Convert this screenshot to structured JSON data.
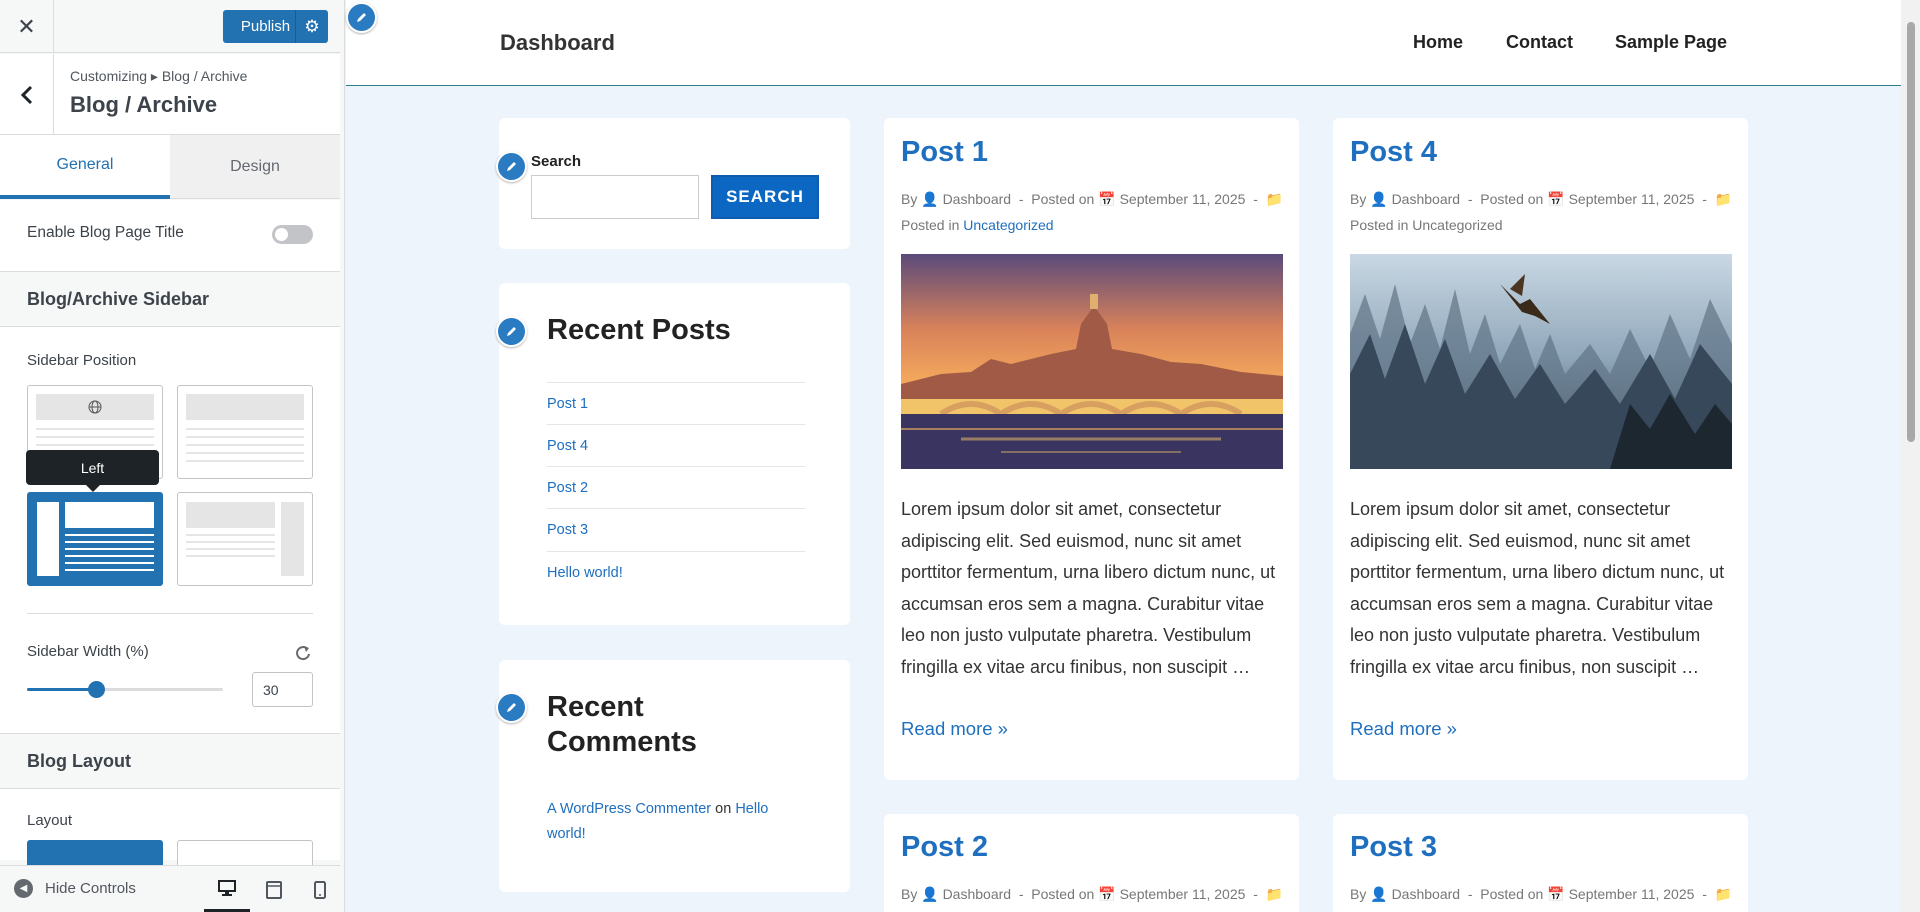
{
  "panel": {
    "publish_label": "Publish",
    "breadcrumb": "Customizing ▸ Blog / Archive",
    "section_title": "Blog / Archive",
    "tabs": [
      {
        "label": "General",
        "active": true
      },
      {
        "label": "Design",
        "active": false
      }
    ],
    "enable_title_label": "Enable Blog Page Title",
    "enable_title_on": false,
    "sidebar_group_title": "Blog/Archive Sidebar",
    "sidebar_position_label": "Sidebar Position",
    "sidebar_position_tooltip": "Left",
    "sidebar_position_selected": "left",
    "sidebar_width_label": "Sidebar Width (%)",
    "sidebar_width_value": "30",
    "sidebar_width_fraction": 0.35,
    "layout_group_title": "Blog Layout",
    "layout_label": "Layout",
    "hide_controls_label": "Hide Controls"
  },
  "site": {
    "title": "Dashboard",
    "nav": [
      "Home",
      "Contact",
      "Sample Page"
    ]
  },
  "sidebar": {
    "search_label": "Search",
    "search_button": "SEARCH",
    "recent_posts_title": "Recent Posts",
    "recent_posts": [
      "Post 1",
      "Post 4",
      "Post 2",
      "Post 3",
      "Hello world!"
    ],
    "recent_comments_title": "Recent Comments",
    "comment_author": "A WordPress Commenter",
    "comment_on": "on",
    "comment_post": "Hello world!"
  },
  "posts": [
    {
      "title": "Post 1",
      "by": "By",
      "author": "Dashboard",
      "posted_on": "Posted on",
      "date": "September 11, 2025",
      "posted_in": "Posted in",
      "category": "Uncategorized",
      "excerpt_lines": [
        "Lorem ipsum dolor sit amet, consectetur",
        "adipiscing elit. Sed euismod, nunc sit amet",
        "porttitor fermentum, urna libero dictum nunc, ut",
        "accumsan eros sem a magna. Curabitur vitae",
        "leo non justo vulputate pharetra. Vestibulum",
        "fringilla ex vitae arcu finibus, non suscipit …"
      ],
      "read_more": "Read more »"
    },
    {
      "title": "Post 4",
      "by": "By",
      "author": "Dashboard",
      "posted_on": "Posted on",
      "date": "September 11, 2025",
      "posted_in": "Posted in",
      "category": "Uncategorized",
      "excerpt_lines": [
        "Lorem ipsum dolor sit amet, consectetur",
        "adipiscing elit. Sed euismod, nunc sit amet",
        "porttitor fermentum, urna libero dictum nunc, ut",
        "accumsan eros sem a magna. Curabitur vitae",
        "leo non justo vulputate pharetra. Vestibulum",
        "fringilla ex vitae arcu finibus, non suscipit …"
      ],
      "read_more": "Read more »"
    },
    {
      "title": "Post 2",
      "by": "By",
      "author": "Dashboard",
      "posted_on": "Posted on",
      "date": "September 11, 2025"
    },
    {
      "title": "Post 3",
      "by": "By",
      "author": "Dashboard",
      "posted_on": "Posted on",
      "date": "September 11, 2025"
    }
  ],
  "meta_separator": "-",
  "colors": {
    "accent": "#2271b1",
    "link": "#1e6fbf",
    "preview_bg": "#eef4fb",
    "search_button": "#0b67c2"
  }
}
